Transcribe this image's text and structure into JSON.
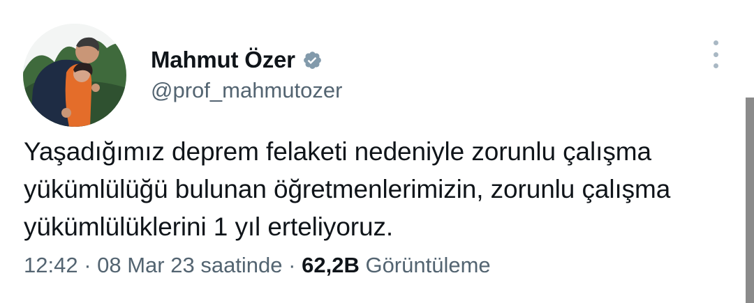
{
  "author": {
    "display_name": "Mahmut Özer",
    "handle": "@prof_mahmutozer",
    "verified_icon": "verified-badge-icon",
    "avatar_icon": "profile-photo"
  },
  "tweet": {
    "text": "Yaşadığımız deprem felaketi nedeniyle zorunlu çalışma yükümlülüğü bulunan öğretmenlerimizin, zorunlu çalışma yükümlülüklerini 1 yıl erteliyoruz."
  },
  "meta": {
    "time": "12:42",
    "separator": " · ",
    "date": "08 Mar 23 saatinde",
    "separator2": " · ",
    "views_count": "62,2B",
    "views_label": " Görüntüleme"
  },
  "menu": {
    "more_icon": "more-vertical-icon"
  },
  "colors": {
    "text_primary": "#0f1419",
    "text_secondary": "#536471",
    "verified_badge": "#829aab"
  }
}
